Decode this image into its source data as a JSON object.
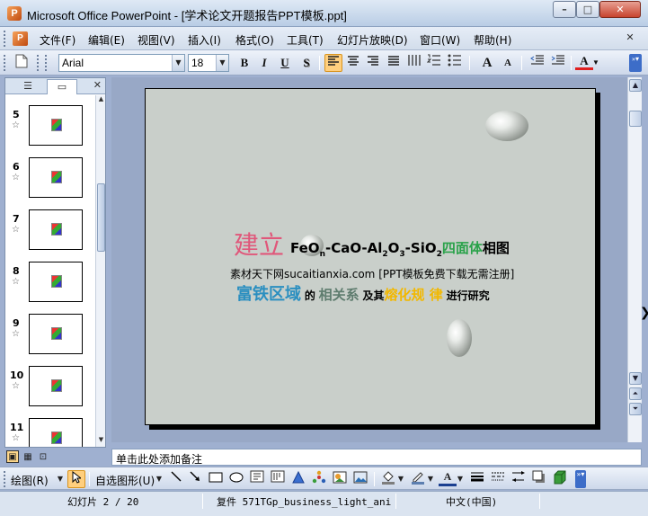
{
  "window": {
    "title": "Microsoft Office PowerPoint - [学术论文开题报告PPT模板.ppt]",
    "min": "–",
    "max": "□",
    "close": "✕"
  },
  "menu": {
    "items": [
      "文件(F)",
      "编辑(E)",
      "视图(V)",
      "插入(I)",
      "格式(O)",
      "工具(T)",
      "幻灯片放映(D)",
      "窗口(W)",
      "帮助(H)"
    ],
    "doc_close": "✕"
  },
  "toolbar": {
    "font": "Arial",
    "size": "18",
    "bold": "B",
    "italic": "I",
    "underline": "U",
    "shadow": "S",
    "grow": "A",
    "shrink": "A",
    "font_color": "A"
  },
  "panel": {
    "close": "✕",
    "slides": [
      "5",
      "6",
      "7",
      "8",
      "9",
      "10",
      "11"
    ]
  },
  "slide": {
    "jianli": "建立",
    "formula_fe": "FeO",
    "formula_n": "n",
    "formula_cao": "-CaO-Al",
    "formula_2a": "2",
    "formula_o": "O",
    "formula_3": "3",
    "formula_si": "-SiO",
    "formula_2b": "2",
    "sub_4": "四面体",
    "xiangtu": "相图",
    "source": "素材天下网sucaitianxia.com [PPT模板免费下载无需注册]",
    "fu": "富铁区域",
    "de": "的",
    "xiang": "相关系",
    "ji": "及其",
    "rong": "熔化规 律",
    "jinxing": "进行研究"
  },
  "notes": {
    "placeholder": "单击此处添加备注"
  },
  "drawbar": {
    "draw": "绘图(R)",
    "autoshapes": "自选图形(U)"
  },
  "status": {
    "slide": "幻灯片 2 / 20",
    "design": "复件 571TGp_business_light_ani",
    "lang": "中文(中国)"
  }
}
